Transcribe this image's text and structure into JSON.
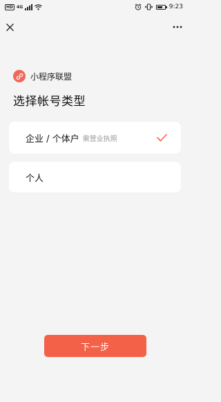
{
  "status_bar": {
    "hd_label": "HD",
    "network_label": "4G",
    "time": "9:23",
    "battery_level": 0.75
  },
  "nav": {
    "close_icon": "close-icon",
    "more_icon": "more-horizontal-icon"
  },
  "brand": {
    "name": "小程序联盟",
    "logo_icon": "link-icon",
    "logo_color": "#f0685a"
  },
  "page_title": "选择帐号类型",
  "options": [
    {
      "label": "企业 / 个体户",
      "sublabel": "需营业执照",
      "selected": true
    },
    {
      "label": "个人",
      "sublabel": "",
      "selected": false
    }
  ],
  "accent_color": "#f36248",
  "next_button_label": "下一步"
}
